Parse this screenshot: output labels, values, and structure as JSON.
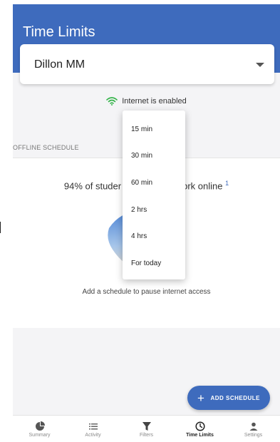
{
  "header": {
    "title": "Time Limits"
  },
  "user_select": {
    "value": "Dillon MM"
  },
  "status": {
    "text": "Internet is enabled",
    "icon": "wifi-icon",
    "color": "#35b44a"
  },
  "section": {
    "label": "OFFLINE SCHEDULE"
  },
  "card": {
    "headline_left": "94% of studer",
    "headline_right": "ork online",
    "footnote": "1",
    "caption": "Add a schedule to pause internet access"
  },
  "fab": {
    "label": "ADD SCHEDULE",
    "plus": "+"
  },
  "dropdown": {
    "options": [
      "15 min",
      "30 min",
      "60 min",
      "2 hrs",
      "4 hrs",
      "For today"
    ]
  },
  "nav": {
    "items": [
      {
        "label": "Summary",
        "icon": "pie-chart-icon"
      },
      {
        "label": "Activity",
        "icon": "list-icon"
      },
      {
        "label": "Filters",
        "icon": "filter-icon"
      },
      {
        "label": "Time Limits",
        "icon": "clock-icon",
        "active": true
      },
      {
        "label": "Settings",
        "icon": "person-icon"
      }
    ]
  },
  "colors": {
    "primary": "#3e6bbd",
    "background": "#f4f4f6"
  }
}
